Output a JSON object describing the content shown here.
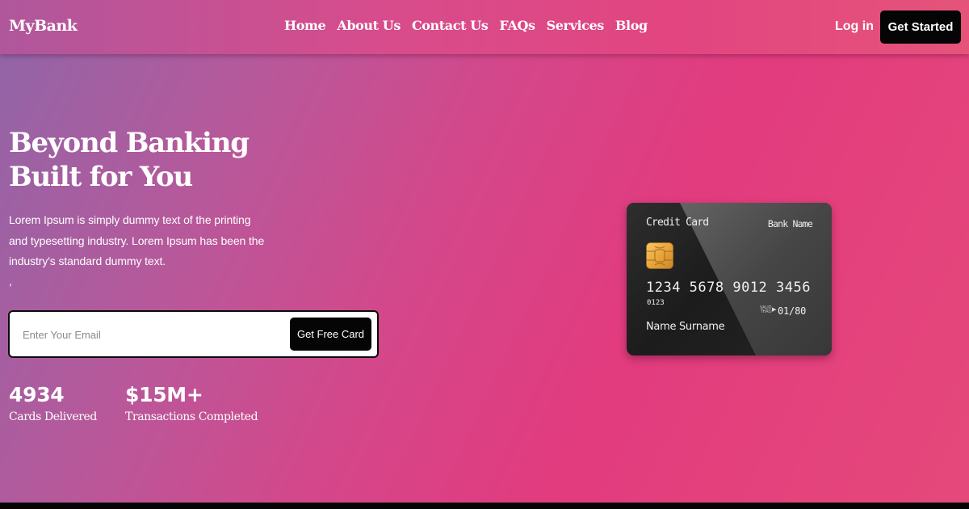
{
  "brand": {
    "name": "MyBank"
  },
  "nav": {
    "links": [
      "Home",
      "About Us",
      "Contact Us",
      "FAQs",
      "Services",
      "Blog"
    ],
    "login_label": "Log in",
    "cta_label": "Get Started"
  },
  "hero": {
    "title_line1": "Beyond Banking",
    "title_line2": "Built for You",
    "description": "Lorem Ipsum is simply dummy text of the printing and typesetting industry. Lorem Ipsum has been the industry's standard dummy text.",
    "stray_text": ","
  },
  "email_form": {
    "placeholder": "Enter Your Email",
    "value": "",
    "button_label": "Get Free Card"
  },
  "stats": [
    {
      "value": "4934",
      "label": "Cards Delivered"
    },
    {
      "value": "$15M+",
      "label": "Transactions Completed"
    }
  ],
  "card": {
    "type_label": "Credit Card",
    "bank_label": "Bank Name",
    "number": "1234  5678  9012  3456",
    "small_number": "0123",
    "valid_label_line1": "VALID",
    "valid_label_line2": "THRU",
    "expiry": "01/80",
    "holder": "Name Surname"
  },
  "colors": {
    "button_bg": "#050505",
    "gradient_start": "#8f66a8",
    "gradient_mid": "#e23b7e",
    "gradient_end": "#e5497a",
    "card_bg": "#1c1c1c",
    "chip_gold": "#e8a53a"
  }
}
